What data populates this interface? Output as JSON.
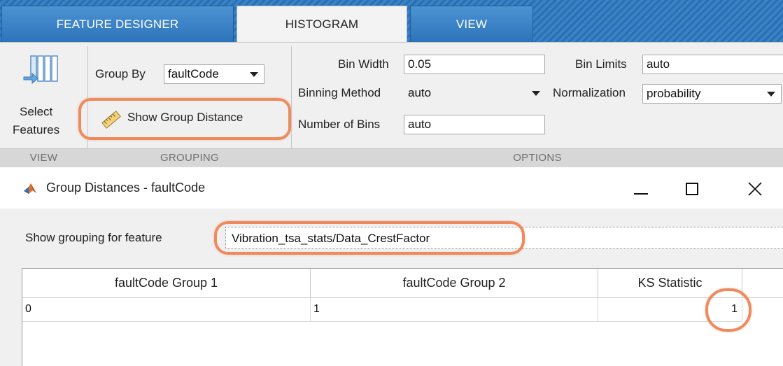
{
  "toolstrip": {
    "tabs": [
      {
        "label": "FEATURE DESIGNER",
        "active": false
      },
      {
        "label": "HISTOGRAM",
        "active": true
      },
      {
        "label": "VIEW",
        "active": false
      }
    ],
    "view_section": {
      "select_features_line1": "Select",
      "select_features_line2": "Features",
      "icon": "select-features-icon",
      "section_label": "VIEW"
    },
    "grouping_section": {
      "group_by_label": "Group By",
      "group_by_value": "faultCode",
      "show_group_distance_label": "Show Group Distance",
      "icon": "ruler-icon",
      "section_label": "GROUPING"
    },
    "options_section": {
      "bin_width_label": "Bin Width",
      "bin_width_value": "0.05",
      "binning_method_label": "Binning Method",
      "binning_method_value": "auto",
      "number_of_bins_label": "Number of Bins",
      "number_of_bins_value": "auto",
      "bin_limits_label": "Bin Limits",
      "bin_limits_value": "auto",
      "normalization_label": "Normalization",
      "normalization_value": "probability",
      "section_label": "OPTIONS"
    }
  },
  "dialog": {
    "title": "Group Distances - faultCode",
    "app_icon": "matlab-icon",
    "feature_label": "Show grouping for feature",
    "feature_value": "Vibration_tsa_stats/Data_CrestFactor",
    "table": {
      "columns": [
        "faultCode Group 1",
        "faultCode Group 2",
        "KS Statistic"
      ],
      "rows": [
        [
          "0",
          "1",
          "1"
        ]
      ]
    }
  },
  "colors": {
    "tab_bar_blue": "#2a6fb3",
    "highlight_orange": "#ef8a5d",
    "ribbon_bg": "#f0f0f0"
  }
}
